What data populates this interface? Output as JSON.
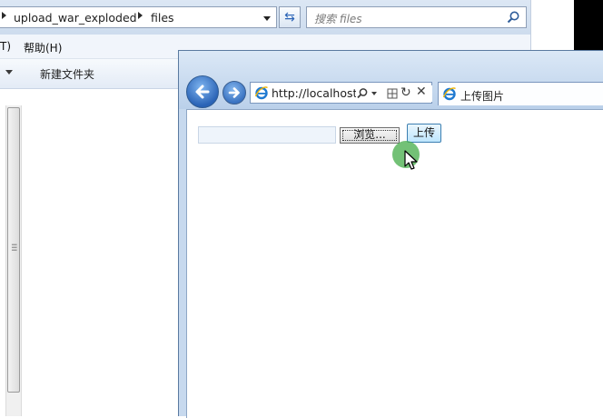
{
  "explorer": {
    "breadcrumb": [
      "upload_war_exploded",
      "files"
    ],
    "search_placeholder": "搜索 files",
    "menu": {
      "partial_item": "T)",
      "help": "帮助(H)"
    },
    "toolbar": {
      "new_folder": "新建文件夹"
    },
    "icons": [
      "refresh-icon",
      "search-icon",
      "dropdown-arrow-icon"
    ]
  },
  "browser": {
    "address": "http://localhost",
    "tab_title": "上传图片",
    "icons": [
      "back-icon",
      "forward-icon",
      "ie-logo-icon",
      "search-icon",
      "compat-view-icon",
      "refresh-icon",
      "stop-icon"
    ]
  },
  "form": {
    "file_value": "",
    "browse_label": "浏览...",
    "upload_label": "上传"
  },
  "colors": {
    "accent": "#2a63b6",
    "click_highlight": "#4caf50"
  }
}
